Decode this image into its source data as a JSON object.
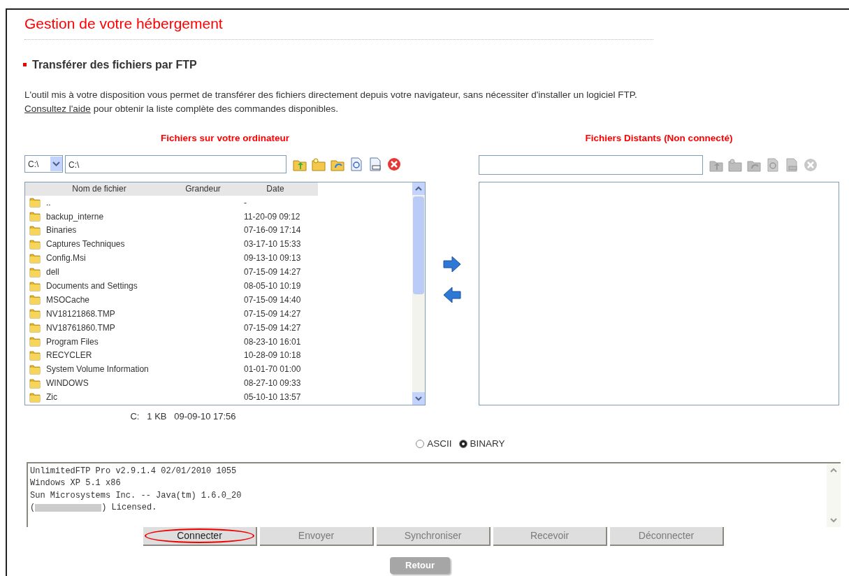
{
  "page_title": "Gestion de votre hébergement",
  "section_title": "Transférer des fichiers par FTP",
  "intro": "L'outil mis à votre disposition vous permet de transférer des fichiers directement depuis votre navigateur, sans nécessiter d'installer un logiciel FTP.",
  "help": {
    "link": "Consultez l'aide",
    "text": " pour obtenir la liste complète des commandes disponibles."
  },
  "local": {
    "title": "Fichiers sur votre ordinateur",
    "drive": "C:\\",
    "path": "C:\\",
    "toolbar_enabled": true,
    "columns": [
      "Nom de fichier",
      "Grandeur",
      "Date"
    ],
    "rows": [
      {
        "name": "..",
        "size": "",
        "date": "-"
      },
      {
        "name": "backup_interne",
        "size": "",
        "date": "11-20-09 09:12"
      },
      {
        "name": "Binaries",
        "size": "",
        "date": "07-16-09 17:14"
      },
      {
        "name": "Captures Techniques",
        "size": "",
        "date": "03-17-10 15:33"
      },
      {
        "name": "Config.Msi",
        "size": "",
        "date": "09-13-10 09:13"
      },
      {
        "name": "dell",
        "size": "",
        "date": "07-15-09 14:27"
      },
      {
        "name": "Documents and Settings",
        "size": "",
        "date": "08-05-10 10:19"
      },
      {
        "name": "MSOCache",
        "size": "",
        "date": "07-15-09 14:40"
      },
      {
        "name": "NV18121868.TMP",
        "size": "",
        "date": "07-15-09 14:27"
      },
      {
        "name": "NV18761860.TMP",
        "size": "",
        "date": "07-15-09 14:27"
      },
      {
        "name": "Program Files",
        "size": "",
        "date": "08-23-10 16:01"
      },
      {
        "name": "RECYCLER",
        "size": "",
        "date": "10-28-09 10:18"
      },
      {
        "name": "System Volume Information",
        "size": "",
        "date": "01-01-70 01:00"
      },
      {
        "name": "WINDOWS",
        "size": "",
        "date": "08-27-10 09:33"
      },
      {
        "name": "Zic",
        "size": "",
        "date": "05-10-10 13:57"
      }
    ],
    "status": "C:   1 KB   09-09-10 17:56"
  },
  "remote": {
    "title": "Fichiers Distants (Non connecté)",
    "toolbar_enabled": false
  },
  "modes": [
    {
      "label": "ASCII",
      "selected": false
    },
    {
      "label": "BINARY",
      "selected": true
    }
  ],
  "log": [
    {
      "text": "UnlimitedFTP Pro v2.9.1.4 02/01/2010 1055"
    },
    {
      "text": "Windows XP 5.1 x86"
    },
    {
      "text": "Sun Microsystems Inc. -- Java(tm) 1.6.0_20"
    },
    {
      "text": "(",
      "redacted": true,
      "after": ") Licensed."
    }
  ],
  "actions": [
    {
      "label": "Connecter",
      "disabled": false,
      "circled": true
    },
    {
      "label": "Envoyer",
      "disabled": true,
      "circled": false
    },
    {
      "label": "Synchroniser",
      "disabled": true,
      "circled": false
    },
    {
      "label": "Recevoir",
      "disabled": true,
      "circled": false
    },
    {
      "label": "Déconnecter",
      "disabled": true,
      "circled": false
    }
  ],
  "back": "Retour"
}
